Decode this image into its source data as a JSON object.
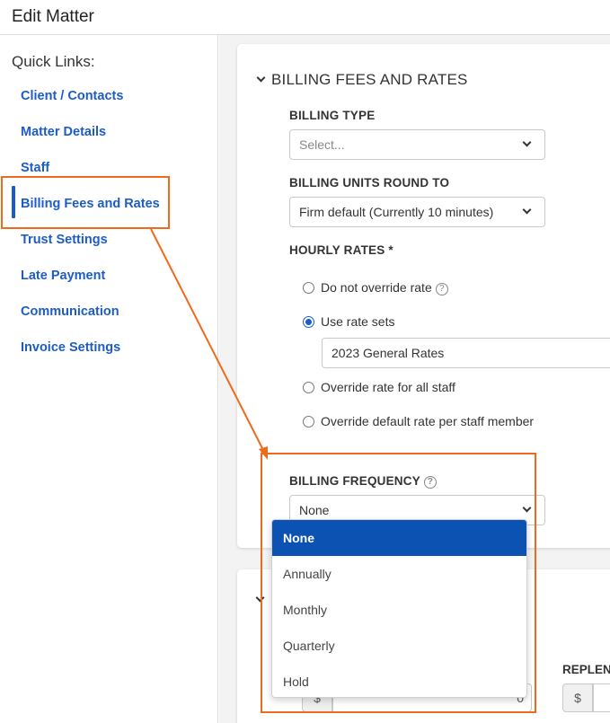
{
  "header": {
    "title": "Edit Matter"
  },
  "sidebar": {
    "title": "Quick Links:",
    "items": [
      {
        "label": "Client / Contacts"
      },
      {
        "label": "Matter Details"
      },
      {
        "label": "Staff"
      },
      {
        "label": "Billing Fees and Rates",
        "active": true
      },
      {
        "label": "Trust Settings"
      },
      {
        "label": "Late Payment"
      },
      {
        "label": "Communication"
      },
      {
        "label": "Invoice Settings"
      }
    ]
  },
  "billing_section": {
    "title": "BILLING FEES AND RATES",
    "billing_type": {
      "label": "BILLING TYPE",
      "placeholder": "Select..."
    },
    "billing_units": {
      "label": "BILLING UNITS ROUND TO",
      "value": "Firm default (Currently 10 minutes)"
    },
    "hourly_rates": {
      "label": "HOURLY RATES *",
      "options": [
        {
          "label": "Do not override rate",
          "selected": false
        },
        {
          "label": "Use rate sets",
          "selected": true
        },
        {
          "label": "Override rate for all staff",
          "selected": false
        },
        {
          "label": "Override default rate per staff member",
          "selected": false
        }
      ],
      "rate_set_value": "2023 General Rates"
    },
    "billing_frequency": {
      "label": "BILLING FREQUENCY",
      "value": "None",
      "options": [
        "None",
        "Annually",
        "Monthly",
        "Quarterly",
        "Hold"
      ],
      "selected_option": "None"
    }
  },
  "trust_section": {
    "replenish_label": "REPLEN",
    "currency_symbol": "$",
    "amount_value": "0"
  },
  "icons": {
    "chevron": "chevron-down-icon",
    "help": "help-circle-icon"
  },
  "help_glyph": "?",
  "colors": {
    "link_blue": "#1d5cc8",
    "selected_option_bg": "#0b52b3",
    "annotation_orange": "#ee6b1e"
  }
}
